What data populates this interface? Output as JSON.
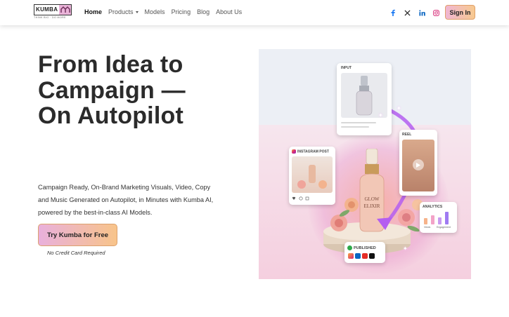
{
  "nav": {
    "logo": {
      "word": "KUMBA",
      "tagline": "THINK BIG · DO MORE",
      "mark": "icon-mark"
    },
    "links": [
      {
        "label": "Home",
        "active": true
      },
      {
        "label": "Products",
        "dropdown": true
      },
      {
        "label": "Models"
      },
      {
        "label": "Pricing"
      },
      {
        "label": "Blog"
      },
      {
        "label": "About Us"
      }
    ],
    "socials": [
      "facebook-icon",
      "x-icon",
      "linkedin-icon",
      "instagram-icon"
    ],
    "signin_label": "Sign In"
  },
  "hero": {
    "title_lines": [
      "From Idea to",
      "Campaign —",
      "On Autopilot"
    ],
    "description_lines": [
      "Campaign Ready, On-Brand Marketing Visuals, Video, Copy",
      "and Music Generated on Autopilot, in Minutes with Kumba AI,",
      "powered by the best-in-class AI Models."
    ],
    "cta_label": "Try Kumba for Free",
    "cta_note": "No Credit Card Required"
  },
  "illustration": {
    "input_label": "INPUT",
    "instagram_label": "INSTAGRAM POST",
    "reel_label": "REEL",
    "analytics_label": "ANALYTICS",
    "analytics_legend": [
      "Views",
      "Engagement"
    ],
    "analytics_bars": [
      0.45,
      0.65,
      0.5,
      0.9
    ],
    "published_label": "PUBLISHED",
    "bottle_text": [
      "GLOW",
      "ELIXIR"
    ],
    "colors": {
      "accent_pink": "#e9b0dc",
      "accent_orange": "#f8c48a",
      "arrow": "#b45ef0",
      "linkedin": "#0a66c2"
    }
  }
}
